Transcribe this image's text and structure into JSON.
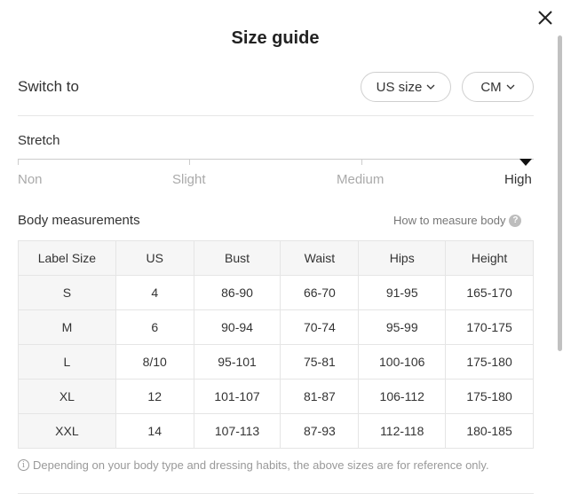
{
  "modal": {
    "title": "Size guide",
    "close_icon": "close-icon"
  },
  "switch": {
    "label": "Switch to",
    "region": "US size",
    "unit": "CM"
  },
  "stretch": {
    "label": "Stretch",
    "levels": [
      "Non",
      "Slight",
      "Medium",
      "High"
    ],
    "selected": "High"
  },
  "measurements": {
    "title": "Body measurements",
    "how_to_link": "How to measure body",
    "help_icon": "question-icon",
    "columns": [
      "Label Size",
      "US",
      "Bust",
      "Waist",
      "Hips",
      "Height"
    ],
    "rows": [
      [
        "S",
        "4",
        "86-90",
        "66-70",
        "91-95",
        "165-170"
      ],
      [
        "M",
        "6",
        "90-94",
        "70-74",
        "95-99",
        "170-175"
      ],
      [
        "L",
        "8/10",
        "95-101",
        "75-81",
        "100-106",
        "175-180"
      ],
      [
        "XL",
        "12",
        "101-107",
        "81-87",
        "106-112",
        "175-180"
      ],
      [
        "XXL",
        "14",
        "107-113",
        "87-93",
        "112-118",
        "180-185"
      ]
    ]
  },
  "note": {
    "icon": "info-icon",
    "text": "Depending on your body type and dressing habits, the above sizes are for reference only."
  },
  "colors": {
    "border": "#e5e5e5",
    "header_bg": "#f6f6f6",
    "muted_text": "#aaaaaa"
  }
}
